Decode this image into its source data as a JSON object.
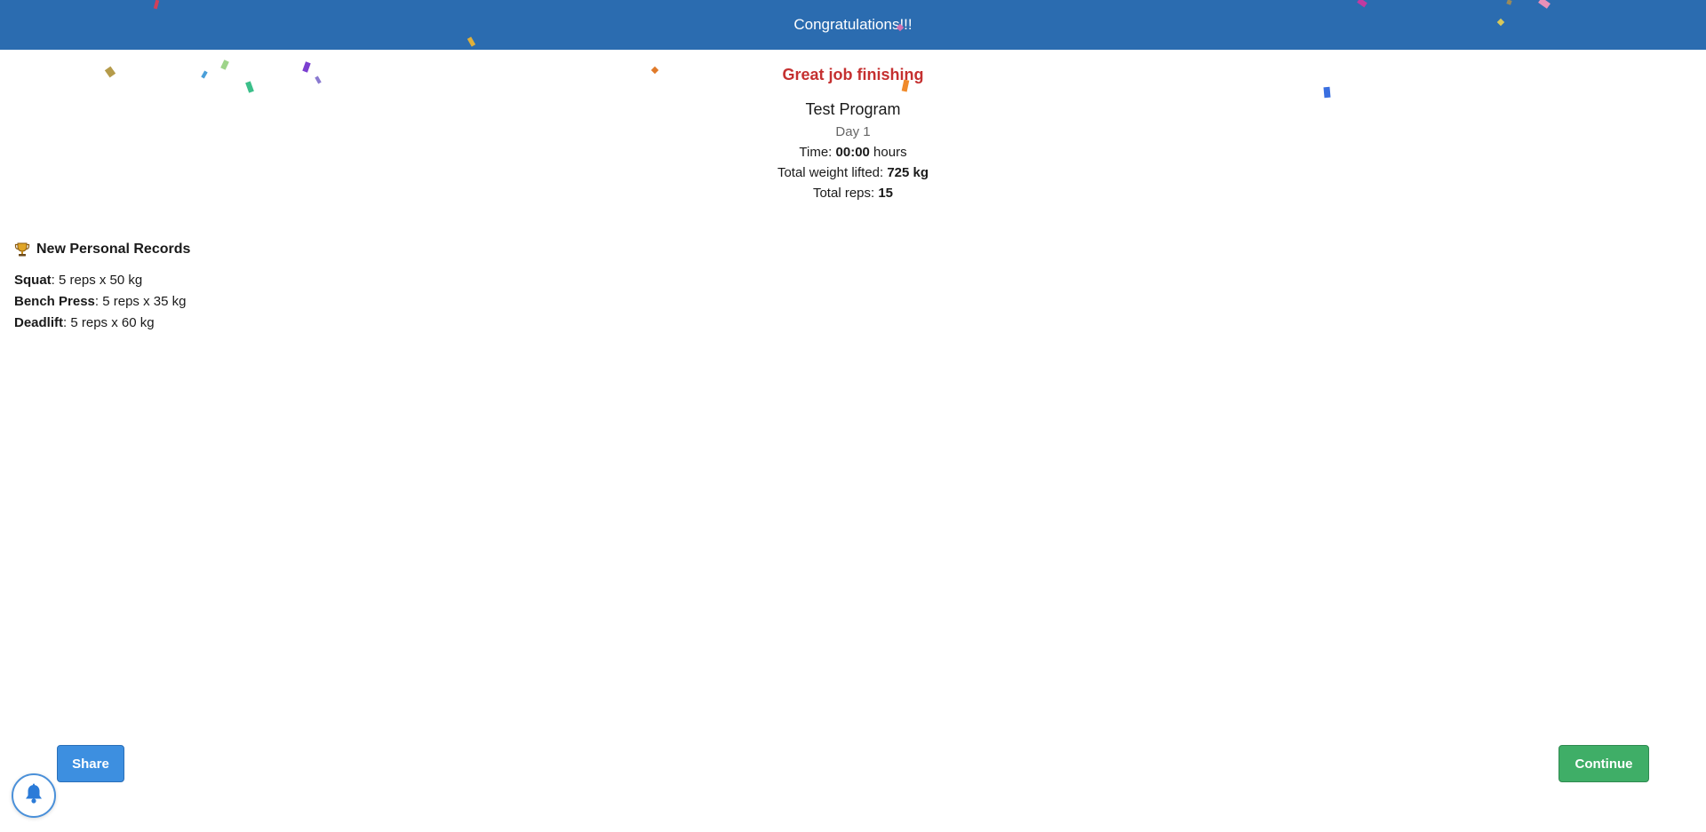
{
  "header": {
    "title": "Congratulations!!!"
  },
  "summary": {
    "headline": "Great job finishing",
    "program_name": "Test Program",
    "day": "Day 1",
    "time_label": "Time: ",
    "time_value": "00:00",
    "time_unit": " hours",
    "weight_label": "Total weight lifted: ",
    "weight_value": "725 kg",
    "reps_label": "Total reps: ",
    "reps_value": "15"
  },
  "records": {
    "title": "New Personal Records",
    "items": [
      {
        "name": "Squat",
        "detail": ": 5 reps x 50 kg"
      },
      {
        "name": "Bench Press",
        "detail": ": 5 reps x 35 kg"
      },
      {
        "name": "Deadlift",
        "detail": ": 5 reps x 60 kg"
      }
    ]
  },
  "actions": {
    "share_label": "Share",
    "continue_label": "Continue"
  },
  "icons": {
    "trophy": "trophy-icon",
    "bell": "bell-icon"
  },
  "colors": {
    "header_bg": "#2b6cb0",
    "headline": "#c53030",
    "share_bg": "#3d8fe0",
    "continue_bg": "#3fae67"
  }
}
